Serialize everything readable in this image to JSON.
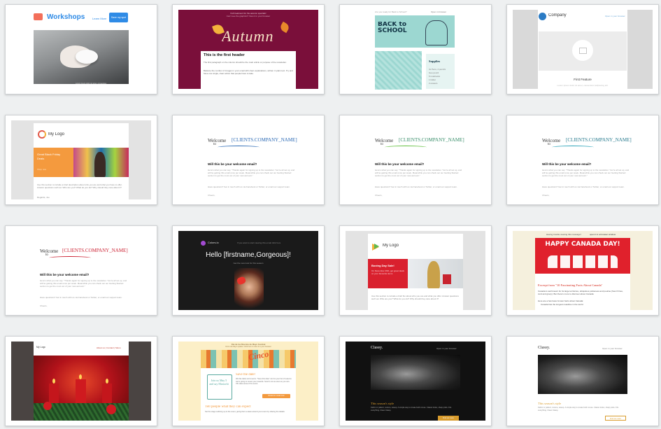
{
  "workshops": {
    "title": "Workshops",
    "nav_link": "Learn More",
    "cta": "Save my spot",
    "caption": "Lorem ipsum dolor sit amet, consectetur"
  },
  "autumn": {
    "top_line": "Full treatment for the autumn specials!",
    "top_line2": "Can't see the graphics? View it in your browser",
    "banner": "Autumn",
    "header": "This is the first header",
    "para1": "The first paragraph on the column should be the main article or purpose of the newsletter.",
    "para2": "Balance the number of images in your email with clear explanations, written in plain text. Try and have one single, clear action that people have to take."
  },
  "school": {
    "top_left": "Are you ready for Back to School?",
    "top_right": "Open in browser",
    "banner": "BACK to SCHOOL",
    "box_title": "Supplies",
    "items": [
      "4x Pens, 2 pencils",
      "Geo pencil",
      "6 notebooks",
      "1 folder",
      "2 erasers"
    ]
  },
  "company": {
    "name": "Company",
    "link": "Open in your browser",
    "feature": "First Feature",
    "feature_sub": "Lorem ipsum dolor sit amet, consectetur adipiscing elit."
  },
  "mylogo1": {
    "logo": "My Logo",
    "promo": "Great Black Friday Deals",
    "promo_sub": "Shop now",
    "body": "Use this section to include a brief description about who you are and what you have to offer. Answer questions such as: Who are you? What do you do? Why should they care about it?",
    "signoff": "Regards, Joe"
  },
  "welcome": {
    "welcome": "Welcome",
    "to": "to",
    "company": "[CLIENTS.COMPANY_NAME]",
    "question": "Will this be your welcome email?",
    "para": "Here's what you can say. \"Thanks again for signing up to the newsletter. You're all set up, and will be getting this email once per week. Meanwhile you can check out our Getting Started section to get the most out of your new account.\"",
    "para2": "Have questions? Get in touch with us via Facebook or Twitter, or email our support team.",
    "signoff": "Cheers,"
  },
  "colors": {
    "brand": "Colors.io",
    "tagline": "If you want to start viewing this email click here",
    "greeting": "Hello [firstname,Gorgeous]!",
    "sub": "Get the new look for this season"
  },
  "mylogo2": {
    "logo": "My Logo",
    "promo": "Boxing Day Sale!",
    "promo_sub": "On December 26th, get great deals on your favourite items",
    "body": "Use this section to include a brief bio about who you are and what you offer. Answer questions such as: Who are you? What do you do? Why should they care about it?"
  },
  "canada": {
    "top_line": "Having trouble viewing this message?",
    "top_link": "open it in a browser window",
    "banner": "HAPPY CANADA DAY!",
    "excerpt": "Excerpt from \"10 Fascinating Facts About Canada\"",
    "para": "Canada is well known for its large territories, ubiquitous politeness and poutine (french fries, curd and gravy). But there's more to discover about Canada:",
    "line": "Here are a few fewer known facts about Canada:",
    "bullet": "Canada has the longest coastline in the world"
  },
  "christmas": {
    "logo": "My Logo",
    "links": "About us | Contact | Menu"
  },
  "cinco": {
    "top": "Dia de los Muertos de Mayo Festival",
    "top2": "Cinco de Mayo update. Click here to view it in your browser",
    "banner": "Cinco",
    "date": "Save the date!",
    "date_body": "We like dates and events. \"Save this date\" can be your list of reasons we're going to renew your rewards. Send it out as soon as you can. It'll make sense if the event.",
    "calendar": "Join us May 5 and say Mariachi",
    "cta": "Reserve a seat now",
    "title2": "Tell people what they can expect",
    "body2": "Set the stage outlining up to the event, giving them a taste around your event by sharing the details."
  },
  "classy1": {
    "brand": "Classy.",
    "link": "Open in your browser",
    "title": "This season's style",
    "body": "Fabric or pattern, texture, sweep. A simple way to create bold moves. Classic looks, sharp picks. Fits everything. Clean Classy.",
    "cta": "Find out more"
  },
  "classy2": {
    "brand": "Classy.",
    "link": "Open in your browser",
    "title": "This season's style",
    "body": "Fabric or pattern, texture, sweep. A simple way to create bold moves. Classic looks, sharp picks. Fits everything. Clean Classy.",
    "cta": "Find out more"
  },
  "colors_palette": {
    "workshops_blue": "#2f8be6",
    "autumn_maroon": "#7a0f3a",
    "school_teal": "#9cd7d1",
    "mylogo_orange": "#f49a3e",
    "welcome_blue": "#2c6ab5",
    "welcome_red": "#cc2233",
    "boxing_red": "#d9202e",
    "canada_red": "#e0212c",
    "cinco_orange": "#f39a3f",
    "classy_gold": "#d99c2d"
  }
}
